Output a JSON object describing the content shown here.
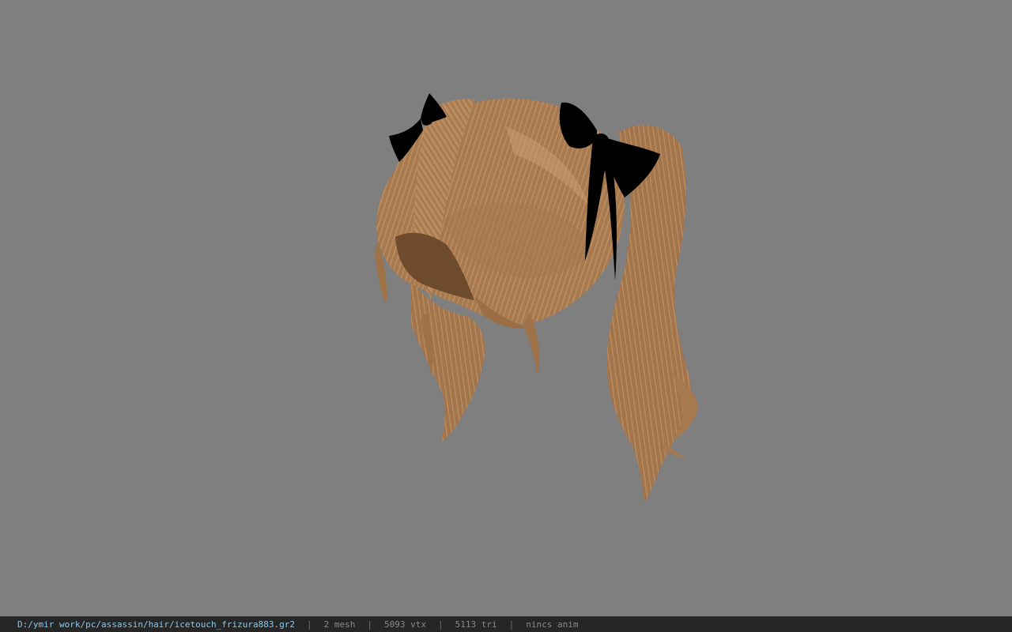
{
  "viewport": {
    "model_name": "hair-model",
    "background_color": "#7f7f7f",
    "hair_color": "#b08256",
    "bow_color": "#000000"
  },
  "status": {
    "file_path": "D:/ymir work/pc/assassin/hair/icetouch_frizura883.gr2",
    "separator": "|",
    "mesh": "2 mesh",
    "vertices": "5093 vtx",
    "triangles": "5113 tri",
    "animation": "nincs anim"
  }
}
